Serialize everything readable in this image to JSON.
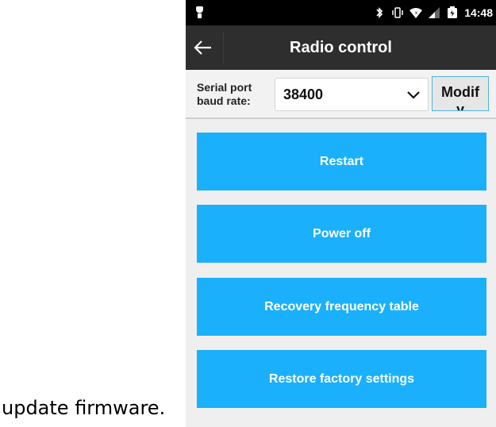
{
  "document": {
    "caption": "update firmware."
  },
  "status_bar": {
    "time": "14:48",
    "icons": [
      "android-icon",
      "bluetooth-icon",
      "vibrate-icon",
      "wifi-icon",
      "signal-icon",
      "battery-icon"
    ]
  },
  "title_bar": {
    "title": "Radio control",
    "back_icon": "back-arrow-icon"
  },
  "baud": {
    "label_line1": "Serial port",
    "label_line2": "baud rate:",
    "value": "38400",
    "modify_line1": "Modif",
    "modify_line2": "y"
  },
  "actions": [
    {
      "label": "Restart"
    },
    {
      "label": "Power off"
    },
    {
      "label": "Recovery frequency table"
    },
    {
      "label": "Restore factory settings"
    }
  ],
  "colors": {
    "accent": "#1ab0fb",
    "title_bar": "#2e2e2e",
    "status_bar": "#000000"
  }
}
